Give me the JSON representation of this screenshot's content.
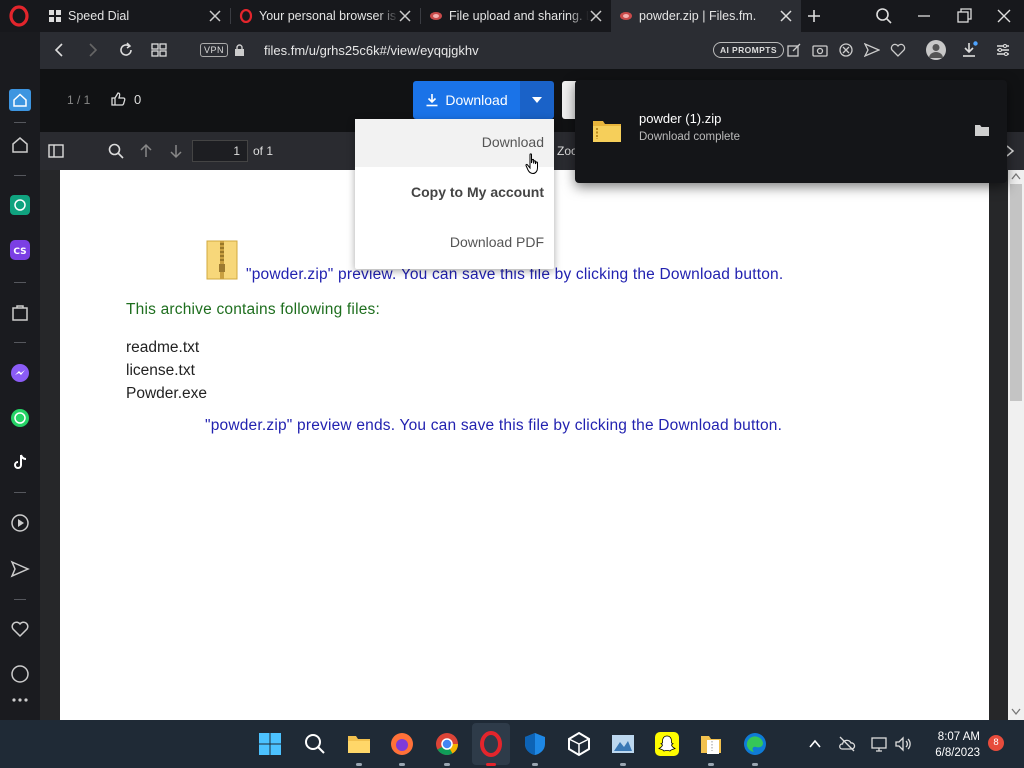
{
  "tabs": [
    {
      "label": "Speed Dial",
      "active": false
    },
    {
      "label": "Your personal browser is a",
      "active": false
    },
    {
      "label": "File upload and sharing. L",
      "active": false
    },
    {
      "label": "powder.zip | Files.fm.",
      "active": true
    }
  ],
  "address": {
    "vpn_label": "VPN",
    "url": "files.fm/u/grhs25c6k#/view/eyqqjgkhv",
    "ai_prompts_label": "AI PROMPTS"
  },
  "page_toolbar": {
    "counter": "1 / 1",
    "likes": "0",
    "download_label": "Download"
  },
  "viewer": {
    "page_value": "1",
    "page_total": "of 1",
    "zoom_fragment": "Zoo"
  },
  "dropdown": {
    "items": [
      "Download",
      "Copy to My account",
      "Download PDF"
    ]
  },
  "document": {
    "preview_start": "\"powder.zip\" preview. You can save this file by clicking the Download button.",
    "archive_title": "This archive contains following files:",
    "files": [
      "readme.txt",
      "license.txt",
      "Powder.exe"
    ],
    "preview_end": "\"powder.zip\" preview ends. You can save this file by clicking the Download button."
  },
  "download_popup": {
    "file_name": "powder (1).zip",
    "status": "Download complete"
  },
  "taskbar": {
    "time": "8:07 AM",
    "date": "6/8/2023",
    "notifications": "8"
  },
  "colors": {
    "accent": "#1a73e8",
    "opera_red": "#e3252c",
    "preview_text": "#2222b0",
    "archive_title": "#1e6e1e"
  }
}
